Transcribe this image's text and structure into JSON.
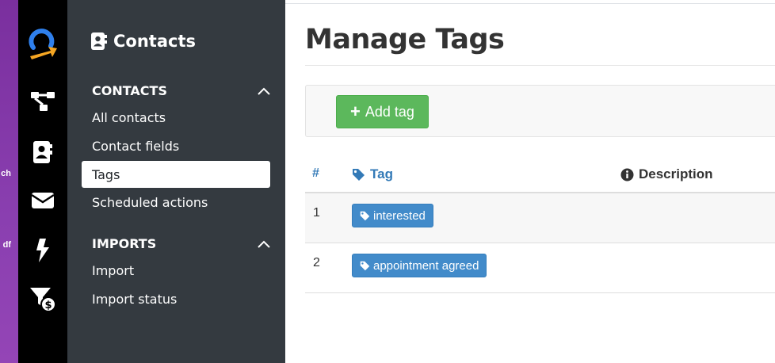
{
  "desktop": {
    "labels": [
      "ch",
      "df"
    ]
  },
  "rail": {
    "icons": [
      "logo-icon",
      "automation-flow-icon",
      "contacts-icon",
      "mail-icon",
      "bolt-icon",
      "funnel-dollar-icon"
    ]
  },
  "sidebar": {
    "title": "Contacts",
    "sections": [
      {
        "label": "CONTACTS",
        "items": [
          "All contacts",
          "Contact fields",
          "Tags",
          "Scheduled actions"
        ],
        "active": "Tags"
      },
      {
        "label": "IMPORTS",
        "items": [
          "Import",
          "Import status"
        ]
      }
    ]
  },
  "main": {
    "title": "Manage Tags",
    "add_button": "Add tag",
    "table": {
      "headers": {
        "num": "#",
        "tag": "Tag",
        "description": "Description"
      },
      "rows": [
        {
          "num": "1",
          "tag": "interested",
          "description": ""
        },
        {
          "num": "2",
          "tag": "appointment agreed",
          "description": ""
        }
      ]
    }
  },
  "colors": {
    "rail": "#000000",
    "sidebar": "#343a40",
    "success": "#5cb85c",
    "badge": "#428bca",
    "link": "#337ab7",
    "logo_blue": "#2f80ed",
    "logo_orange": "#f5a623"
  }
}
